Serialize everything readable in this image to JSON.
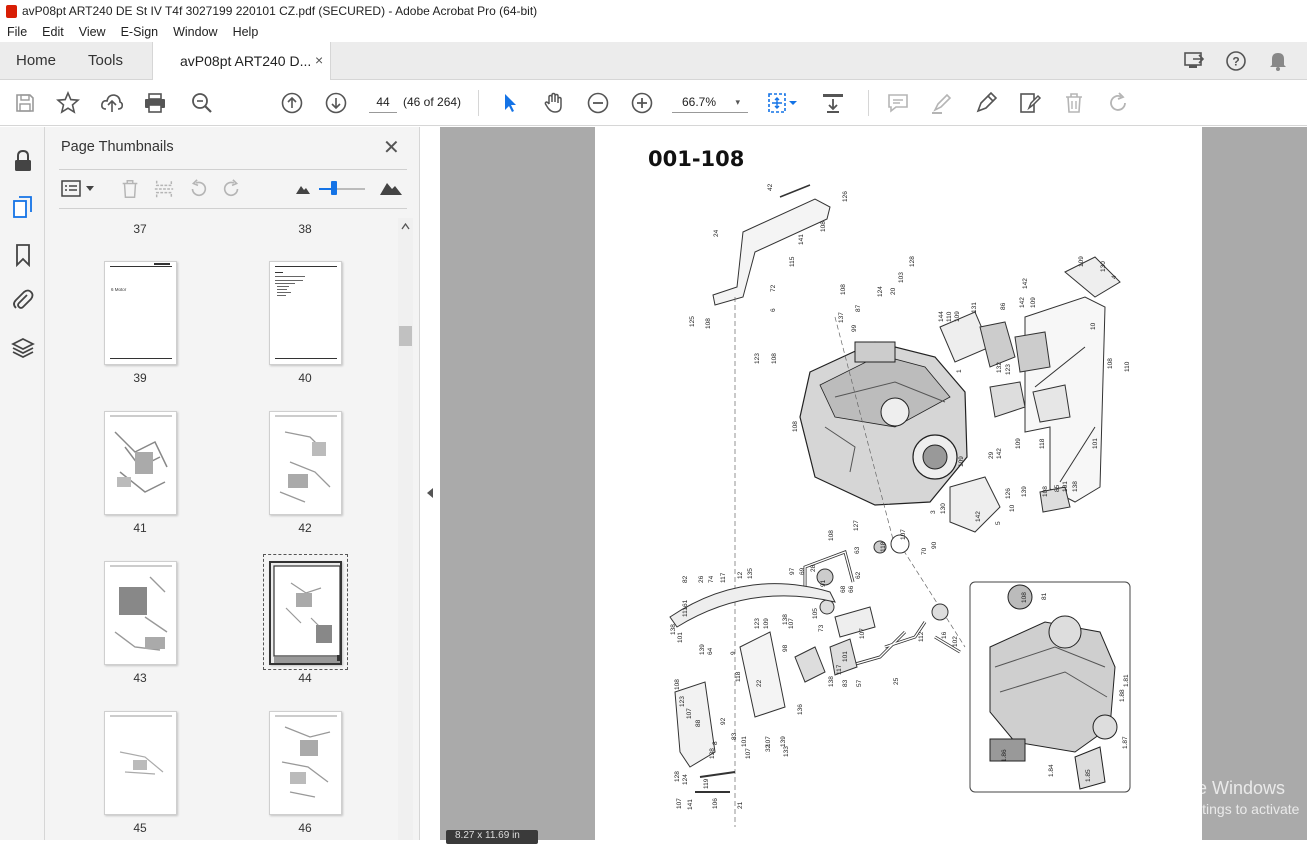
{
  "window": {
    "title": "avP08pt ART240 DE St IV T4f 3027199 220101 CZ.pdf (SECURED) - Adobe Acrobat Pro (64-bit)"
  },
  "menu": [
    "File",
    "Edit",
    "View",
    "E-Sign",
    "Window",
    "Help"
  ],
  "tabs": {
    "home": "Home",
    "tools": "Tools",
    "document": "avP08pt ART240 D...",
    "close": "×"
  },
  "toolbar": {
    "page_input": "44",
    "page_count": "(46 of 264)",
    "zoom": "66.7%",
    "zoom_caret": "▾"
  },
  "panel": {
    "title": "Page Thumbnails",
    "close": "✕",
    "pages": [
      {
        "num": "37"
      },
      {
        "num": "38"
      },
      {
        "num": "39",
        "heading": "6  Motor"
      },
      {
        "num": "40"
      },
      {
        "num": "41"
      },
      {
        "num": "42"
      },
      {
        "num": "43"
      },
      {
        "num": "44",
        "selected": true
      },
      {
        "num": "45"
      },
      {
        "num": "46"
      }
    ]
  },
  "document": {
    "title": "001-108",
    "labels": [
      "42",
      "126",
      "24",
      "108",
      "141",
      "115",
      "72",
      "6",
      "137",
      "108",
      "125",
      "108",
      "123",
      "108",
      "87",
      "99",
      "124",
      "20",
      "103",
      "128",
      "144",
      "110",
      "109",
      "131",
      "86",
      "142",
      "109",
      "142",
      "109",
      "130",
      "4",
      "10",
      "108",
      "110",
      "132",
      "123",
      "108",
      "1",
      "29",
      "142",
      "109",
      "118",
      "101",
      "3",
      "130",
      "109",
      "142",
      "5",
      "10",
      "126",
      "139",
      "108",
      "85",
      "101",
      "138",
      "108",
      "127",
      "63",
      "118",
      "107",
      "90",
      "70",
      "97",
      "69",
      "28",
      "91",
      "68",
      "66",
      "62",
      "82",
      "26",
      "74",
      "117",
      "12",
      "135",
      "107",
      "138",
      "109",
      "123",
      "105",
      "61",
      "111",
      "73",
      "107",
      "112",
      "16",
      "102",
      "138",
      "101",
      "139",
      "64",
      "9",
      "98",
      "101",
      "117",
      "83",
      "57",
      "25",
      "108",
      "123",
      "107",
      "88",
      "92",
      "8",
      "138",
      "83",
      "101",
      "107",
      "118",
      "22",
      "107",
      "139",
      "136",
      "138",
      "128",
      "124",
      "119",
      "107",
      "141",
      "106",
      "21",
      "32",
      "133",
      "108",
      "81",
      "1.81",
      "1.88",
      "1.87",
      "1.86",
      "1.85",
      "1.84"
    ]
  },
  "status": {
    "page_size": "8.27 x 11.69 in"
  },
  "watermark": {
    "line1": "Activate Windows",
    "line2": "Go to Settings to activate"
  },
  "colors": {
    "pdf_red": "#d81e05",
    "accent_blue": "#1473e6",
    "viewer_bg": "#aaaaaa"
  }
}
